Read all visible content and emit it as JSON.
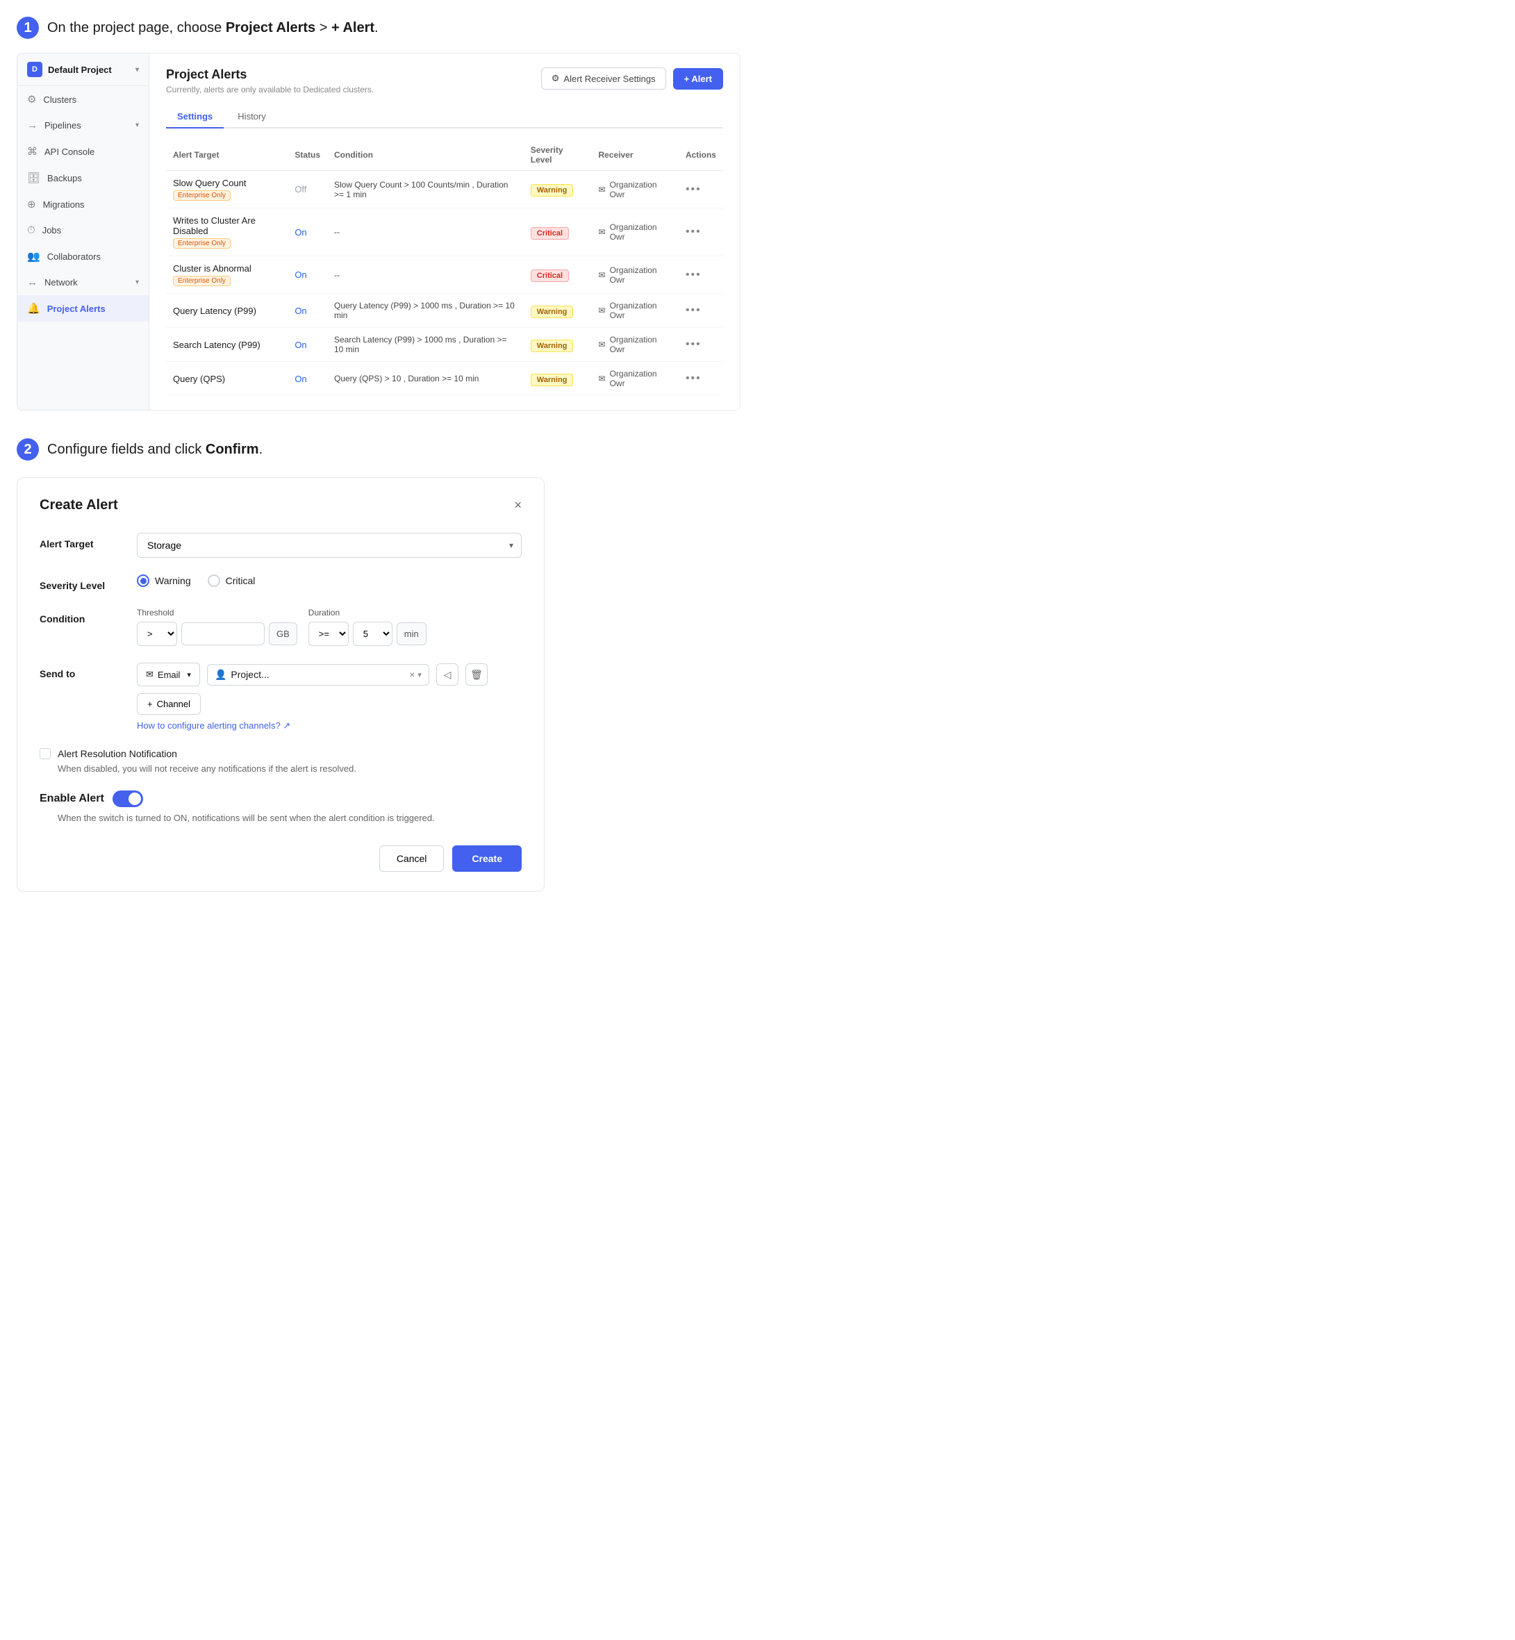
{
  "step1": {
    "number": "1",
    "text_prefix": "On the project page, choose ",
    "highlight": "Project Alerts",
    "text_arrow": " > ",
    "highlight2": "+ Alert",
    "text_suffix": "."
  },
  "step2": {
    "number": "2",
    "text_prefix": "Configure fields and click ",
    "highlight": "Confirm",
    "text_suffix": "."
  },
  "sidebar": {
    "project_name": "Default Project",
    "project_initial": "D",
    "items": [
      {
        "label": "Clusters",
        "icon": "⚙",
        "active": false
      },
      {
        "label": "Pipelines",
        "icon": "→",
        "active": false,
        "expandable": true
      },
      {
        "label": "API Console",
        "icon": ">_",
        "active": false
      },
      {
        "label": "Backups",
        "icon": "⊟",
        "active": false
      },
      {
        "label": "Migrations",
        "icon": "⊕",
        "active": false
      },
      {
        "label": "Jobs",
        "icon": "⏱",
        "active": false
      },
      {
        "label": "Collaborators",
        "icon": "👥",
        "active": false
      },
      {
        "label": "Network",
        "icon": "↔",
        "active": false,
        "expandable": true
      },
      {
        "label": "Project Alerts",
        "icon": "🔔",
        "active": true
      }
    ]
  },
  "main": {
    "title": "Project Alerts",
    "subtitle": "Currently, alerts are only available to Dedicated clusters.",
    "btn_receiver": "Alert Receiver Settings",
    "btn_add": "+ Alert",
    "tabs": [
      {
        "label": "Settings",
        "active": true
      },
      {
        "label": "History",
        "active": false
      }
    ],
    "table": {
      "headers": [
        "Alert Target",
        "Status",
        "Condition",
        "Severity Level",
        "Receiver",
        "Actions"
      ],
      "rows": [
        {
          "target": "Slow Query Count",
          "enterprise": true,
          "status": "Off",
          "status_on": false,
          "condition": "Slow Query Count > 100 Counts/min , Duration >= 1 min",
          "severity": "Warning",
          "severity_type": "warning",
          "receiver": "Organization Owr"
        },
        {
          "target": "Writes to Cluster Are Disabled",
          "enterprise": true,
          "status": "On",
          "status_on": true,
          "condition": "--",
          "severity": "Critical",
          "severity_type": "critical",
          "receiver": "Organization Owr"
        },
        {
          "target": "Cluster is Abnormal",
          "enterprise": true,
          "status": "On",
          "status_on": true,
          "condition": "--",
          "severity": "Critical",
          "severity_type": "critical",
          "receiver": "Organization Owr"
        },
        {
          "target": "Query Latency (P99)",
          "enterprise": false,
          "status": "On",
          "status_on": true,
          "condition": "Query Latency (P99) > 1000 ms , Duration >= 10 min",
          "severity": "Warning",
          "severity_type": "warning",
          "receiver": "Organization Owr"
        },
        {
          "target": "Search Latency (P99)",
          "enterprise": false,
          "status": "On",
          "status_on": true,
          "condition": "Search Latency (P99) > 1000 ms , Duration >= 10 min",
          "severity": "Warning",
          "severity_type": "warning",
          "receiver": "Organization Owr"
        },
        {
          "target": "Query (QPS)",
          "enterprise": false,
          "status": "On",
          "status_on": true,
          "condition": "Query (QPS) > 10 , Duration >= 10 min",
          "severity": "Warning",
          "severity_type": "warning",
          "receiver": "Organization Owr"
        }
      ]
    }
  },
  "dialog": {
    "title": "Create Alert",
    "close_label": "×",
    "alert_target_label": "Alert Target",
    "alert_target_value": "Storage",
    "severity_label": "Severity Level",
    "severity_options": [
      {
        "label": "Warning",
        "selected": true
      },
      {
        "label": "Critical",
        "selected": false
      }
    ],
    "condition_label": "Condition",
    "threshold_label": "Threshold",
    "threshold_operator": ">",
    "threshold_value": "",
    "threshold_unit": "GB",
    "duration_label": "Duration",
    "duration_operator": ">=",
    "duration_value": "5",
    "duration_unit": "min",
    "send_to_label": "Send to",
    "email_label": "Email",
    "recipient_tag": "Project...",
    "add_channel_label": "+ Channel",
    "configure_link": "How to configure alerting channels? ↗",
    "resolution_checkbox_label": "Alert Resolution Notification",
    "resolution_helper": "When disabled, you will not receive any notifications if the alert is resolved.",
    "enable_label": "Enable Alert",
    "enable_helper": "When the switch is turned to ON, notifications will be sent when the alert condition is triggered.",
    "cancel_label": "Cancel",
    "create_label": "Create"
  }
}
